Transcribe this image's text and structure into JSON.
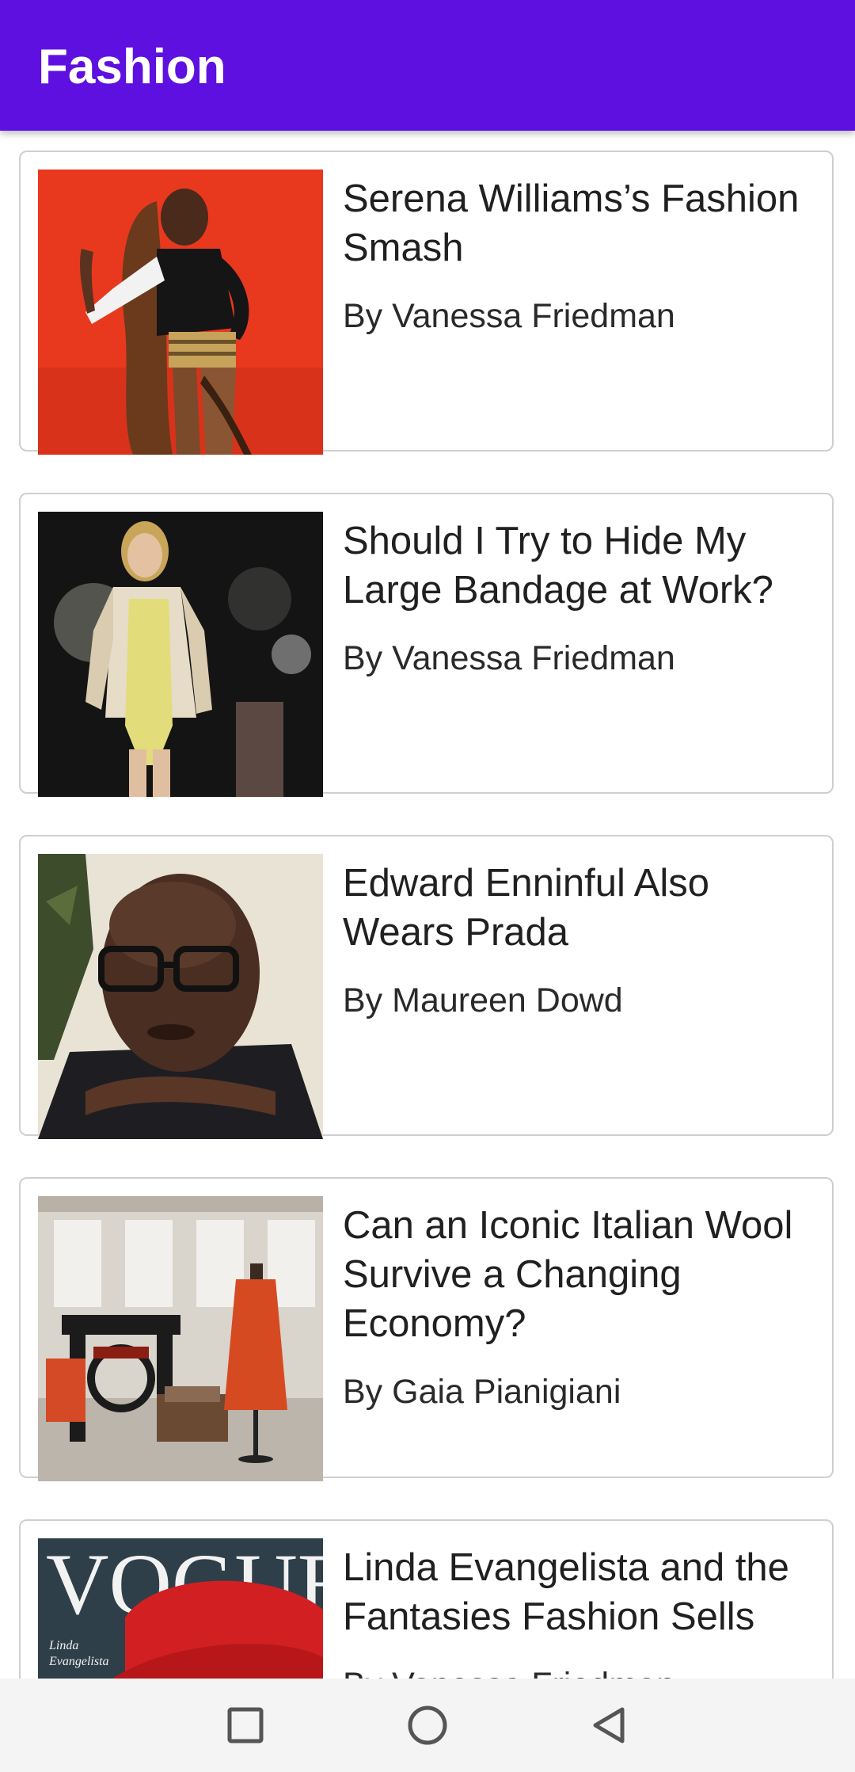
{
  "appbar": {
    "title": "Fashion",
    "color": "#5e10e0"
  },
  "articles": [
    {
      "title": "Serena Williams’s Fashion Smash",
      "byline": "By Vanessa Friedman",
      "image": "serena-williams-photo"
    },
    {
      "title": "Should I Try to Hide My Large Bandage at Work?",
      "byline": "By Vanessa Friedman",
      "image": "runway-model-photo"
    },
    {
      "title": "Edward Enninful Also Wears Prada",
      "byline": "By Maureen Dowd",
      "image": "edward-enninful-portrait"
    },
    {
      "title": "Can an Iconic Italian Wool Survive a Changing Economy?",
      "byline": "By Gaia Pianigiani",
      "image": "wool-loom-showroom-photo"
    },
    {
      "title": "Linda Evangelista and the Fantasies Fashion Sells",
      "byline": "By Vanessa Friedman",
      "image": "vogue-cover-photo"
    }
  ],
  "navbar": {
    "recents_icon": "square-icon",
    "home_icon": "circle-icon",
    "back_icon": "triangle-back-icon"
  }
}
